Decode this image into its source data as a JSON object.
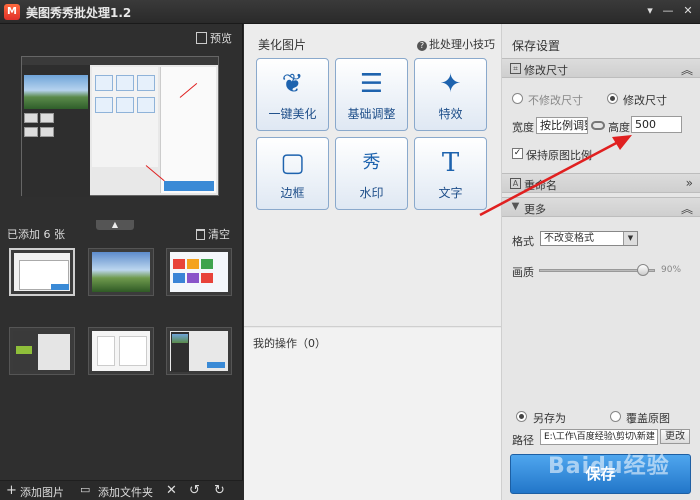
{
  "window": {
    "title": "美图秀秀批处理1.2",
    "controls": [
      "▾",
      "—",
      "✕"
    ]
  },
  "left_panel": {
    "preview_label": "预览",
    "count_text": "已添加 6 张",
    "clear_label": "清空",
    "bottom_bar": {
      "add_images": "添加图片",
      "add_folder": "添加文件夹"
    }
  },
  "center_panel": {
    "heading": "美化图片",
    "tips_link": "批处理小技巧",
    "tools": [
      {
        "label": "一键美化",
        "icon": "tulip-icon"
      },
      {
        "label": "基础调整",
        "icon": "sliders-icon"
      },
      {
        "label": "特效",
        "icon": "magic-wand-icon"
      },
      {
        "label": "边框",
        "icon": "frame-icon"
      },
      {
        "label": "水印",
        "icon": "watermark-seal-icon"
      },
      {
        "label": "文字",
        "icon": "text-t-icon"
      }
    ],
    "tool_glyphs": [
      "❦",
      "☰",
      "✦",
      "▢",
      "秀",
      "T"
    ],
    "my_ops": "我的操作（0）"
  },
  "right_panel": {
    "title": "保存设置",
    "resize_section": {
      "label": "修改尺寸",
      "option_keep": "不修改尺寸",
      "option_change": "修改尺寸",
      "selected": "修改尺寸",
      "width_label": "宽度",
      "width_value": "按比例调整",
      "height_label": "高度",
      "height_value": "500",
      "keep_ratio_label": "保持原图比例",
      "keep_ratio_checked": true
    },
    "rename_section": {
      "label": "重命名"
    },
    "more_section": {
      "label": "更多",
      "format_label": "格式",
      "format_value": "不改变格式",
      "quality_label": "画质",
      "quality_value": "90%",
      "quality_level": 0.9
    },
    "save_as_label": "另存为",
    "overwrite_label": "覆盖原图",
    "save_mode_selected": "另存为",
    "path_label": "路径",
    "path_value": "E:\\工作\\百度经验\\剪切\\新建",
    "change_label": "更改",
    "save_button": "保存"
  },
  "watermark_text": "Baidu经验",
  "colors": {
    "accent_blue": "#2276c9",
    "tool_text": "#1f4f8a",
    "annotation_red": "#e02020"
  }
}
